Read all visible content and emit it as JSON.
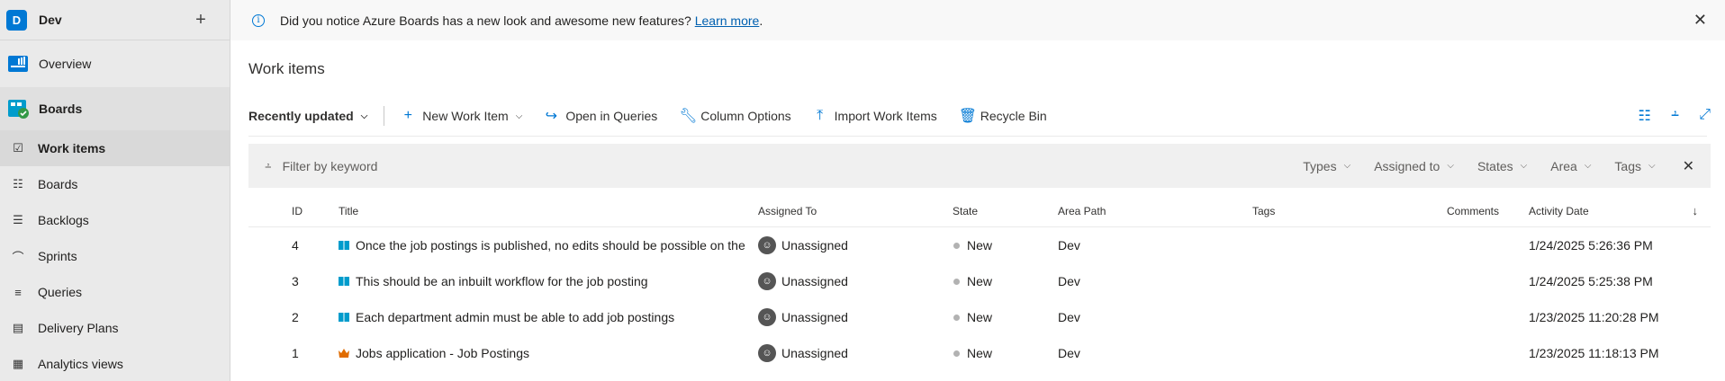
{
  "project": {
    "badge": "D",
    "name": "Dev"
  },
  "nav": {
    "overview": "Overview",
    "boards_hub": "Boards",
    "items": [
      {
        "label": "Work items",
        "icon": "work-items-icon",
        "glyph": "☑"
      },
      {
        "label": "Boards",
        "icon": "boards-icon",
        "glyph": "☷"
      },
      {
        "label": "Backlogs",
        "icon": "backlogs-icon",
        "glyph": "☰"
      },
      {
        "label": "Sprints",
        "icon": "sprints-icon",
        "glyph": "⌒"
      },
      {
        "label": "Queries",
        "icon": "queries-icon",
        "glyph": "≡"
      },
      {
        "label": "Delivery Plans",
        "icon": "delivery-plans-icon",
        "glyph": "▤"
      },
      {
        "label": "Analytics views",
        "icon": "analytics-views-icon",
        "glyph": "▦"
      }
    ]
  },
  "banner": {
    "message": "Did you notice Azure Boards has a new look and awesome new features?",
    "link": "Learn more",
    "period": "."
  },
  "page": {
    "title": "Work items"
  },
  "toolbar": {
    "pivot": "Recently updated",
    "new_work_item": "New Work Item",
    "open_in_queries": "Open in Queries",
    "column_options": "Column Options",
    "import_work_items": "Import Work Items",
    "recycle_bin": "Recycle Bin"
  },
  "filter": {
    "placeholder": "Filter by keyword",
    "dropdowns": [
      "Types",
      "Assigned to",
      "States",
      "Area",
      "Tags"
    ]
  },
  "grid": {
    "columns": {
      "id": "ID",
      "title": "Title",
      "assigned_to": "Assigned To",
      "state": "State",
      "area_path": "Area Path",
      "tags": "Tags",
      "comments": "Comments",
      "activity_date": "Activity Date"
    },
    "rows": [
      {
        "id": "4",
        "type": "user-story",
        "title": "Once the job postings is published, no edits should be possible on the",
        "assigned": "Unassigned",
        "state": "New",
        "area": "Dev",
        "tags": "",
        "comments": "",
        "date": "1/24/2025 5:26:36 PM"
      },
      {
        "id": "3",
        "type": "user-story",
        "title": "This should be an inbuilt workflow for the job posting",
        "assigned": "Unassigned",
        "state": "New",
        "area": "Dev",
        "tags": "",
        "comments": "",
        "date": "1/24/2025 5:25:38 PM"
      },
      {
        "id": "2",
        "type": "user-story",
        "title": "Each department admin must be able to add job postings",
        "assigned": "Unassigned",
        "state": "New",
        "area": "Dev",
        "tags": "",
        "comments": "",
        "date": "1/23/2025 11:20:28 PM"
      },
      {
        "id": "1",
        "type": "epic",
        "title": "Jobs application - Job Postings",
        "assigned": "Unassigned",
        "state": "New",
        "area": "Dev",
        "tags": "",
        "comments": "",
        "date": "1/23/2025 11:18:13 PM"
      }
    ]
  },
  "colors": {
    "accent": "#0078d4",
    "user_story": "#009ccc",
    "epic": "#e06c00",
    "state_new": "#b2b2b2"
  }
}
